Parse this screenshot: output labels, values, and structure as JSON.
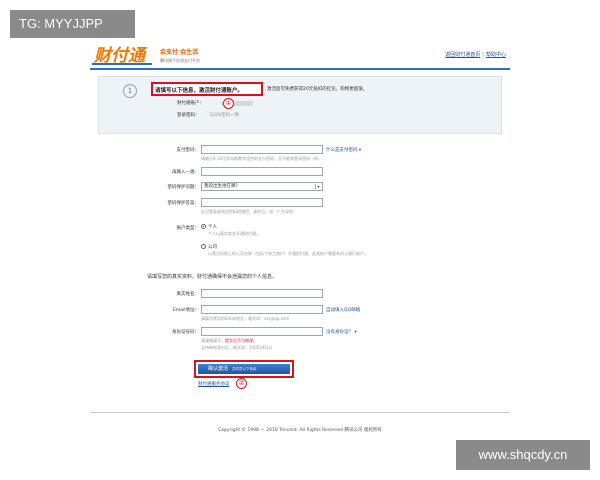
{
  "watermarks": {
    "top_left": "TG: MYYJJPP",
    "bottom_right": "www.shqcdy.cn"
  },
  "header": {
    "logo_text": "财付通",
    "slogan_main": "会支付 会生活",
    "slogan_sub": "腾讯旗下在线支付平台",
    "links": [
      "返回财付通首页",
      "帮助中心"
    ]
  },
  "notice": {
    "title": "请填写以下信息，激活财付通账户。",
    "text": "激活后可免费获得20元抵扣的红包，购物更超值。",
    "account_label": "财付通账户：",
    "password_label": "登录密码：",
    "password_value": "与QQ密码一致",
    "marker_1": "①"
  },
  "form": {
    "pay_password_label": "支付密码：",
    "pay_password_link": "什么是支付密码",
    "pay_password_hint": "请输入6-16位字母和数字组合的支付密码，且不能和登录密码一样。",
    "repeat_label": "再输入一遍：",
    "question_label": "密码保护问题：",
    "question_value": "我的出生地在哪?",
    "answer_label": "密码保护答案：",
    "answer_hint": "忘记登录或找回密码时使用，请牢记。如：广东深圳",
    "account_type_label": "账户类型：",
    "type_personal": "个人",
    "type_personal_hint": "个人以真实姓名开通财付通。",
    "type_company": "公司",
    "type_company_hint": "以营业执照上的公司名称（包括个体工商户）开通财付通，此类账户需要有对公银行账户。",
    "section_title": "请填写您的真实资料。财付通确保不会泄漏您的个人信息。",
    "name_label": "真实姓名：",
    "email_label": "Email地址：",
    "email_link": "自动填入QQ邮箱",
    "email_hint": "请填写常用的Email地址，格式如：sss@qq.com",
    "id_label": "身份证号码：",
    "id_link": "没有身份证？",
    "id_hint_1": "请谨慎填写，",
    "id_hint_warn": "提交后不可修改。",
    "id_hint_2": "支持带电身份证，格式如：1402345(s)",
    "submit_label": "确认激活",
    "submit_sub": "并同意以下条款",
    "agreement_link": "财付通服务协议",
    "marker_2": "②"
  },
  "footer": {
    "copyright": "Copyright © 1998 － 2010 Tencent. All Rights Reserved 腾讯公司 版权所有"
  }
}
